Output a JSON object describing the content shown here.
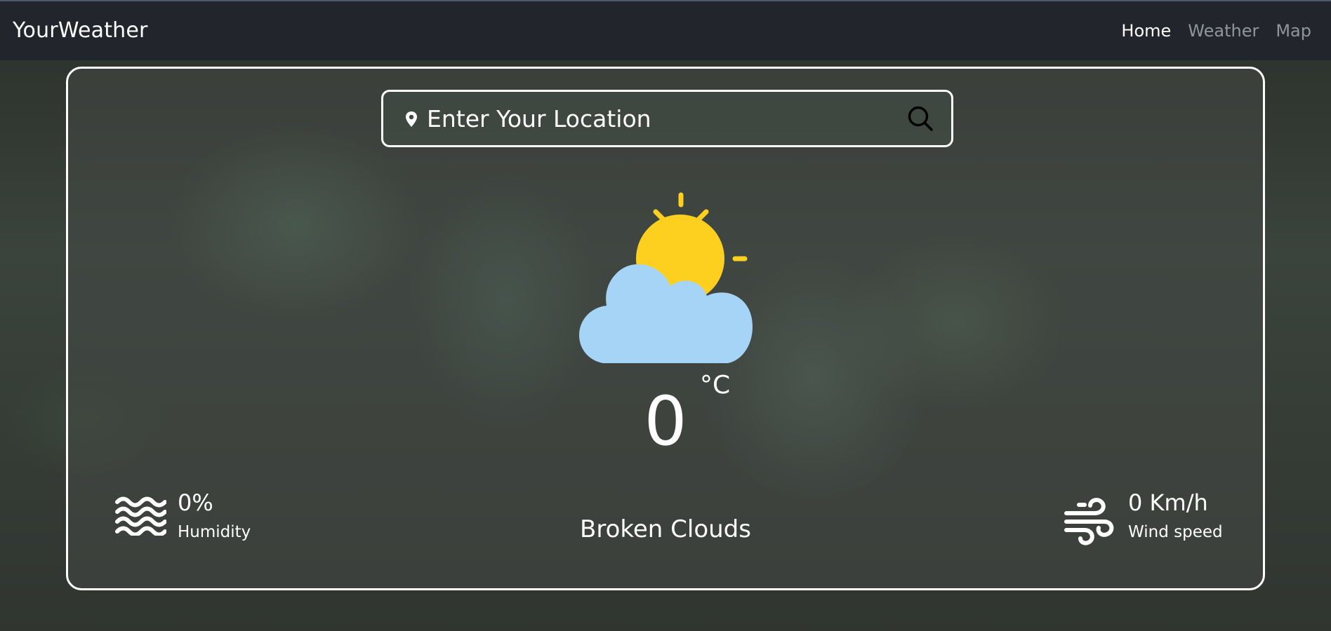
{
  "header": {
    "brand": "YourWeather",
    "nav": [
      {
        "label": "Home",
        "active": true
      },
      {
        "label": "Weather",
        "active": false
      },
      {
        "label": "Map",
        "active": false
      }
    ]
  },
  "search": {
    "placeholder": "Enter Your Location",
    "value": "",
    "icons": {
      "location": "map-pin-icon",
      "submit": "search-icon"
    }
  },
  "weather": {
    "icon": "partly-cloudy-icon",
    "temperature": "0",
    "unit": "°C",
    "condition": "Broken Clouds",
    "humidity": {
      "value": "0%",
      "label": "Humidity",
      "icon": "humidity-waves-icon"
    },
    "wind": {
      "value": "0 Km/h",
      "label": "Wind speed",
      "icon": "wind-icon"
    }
  },
  "colors": {
    "header_bg": "#22262c",
    "sun": "#fdd020",
    "cloud": "#a6d4f6",
    "nav_inactive": "#8f959c",
    "text": "#ffffff"
  }
}
